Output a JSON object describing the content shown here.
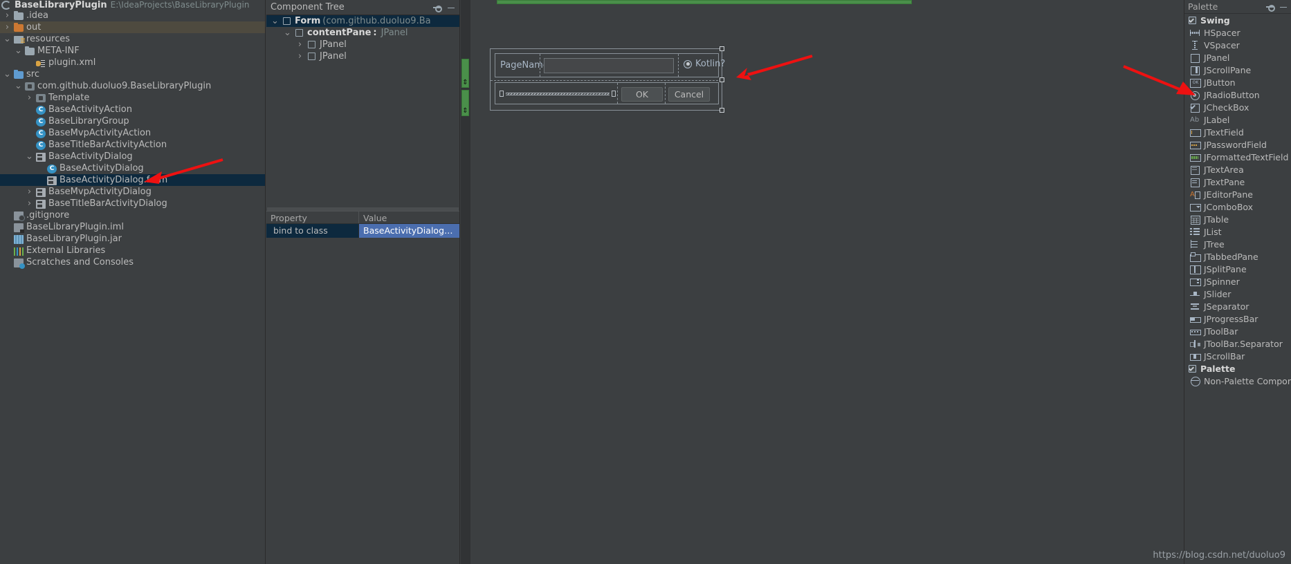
{
  "project": {
    "title": "BaseLibraryPlugin",
    "path": "E:\\IdeaProjects\\BaseLibraryPlugin",
    "items": [
      {
        "label": ".idea",
        "indent": 0,
        "arrow": "collapsed",
        "icon": "folder-gray-icon",
        "state": "normal"
      },
      {
        "label": "out",
        "indent": 0,
        "arrow": "collapsed",
        "icon": "folder-orange-icon",
        "state": "highlight"
      },
      {
        "label": "resources",
        "indent": 0,
        "arrow": "expanded",
        "icon": "resources-folder-icon",
        "state": "normal"
      },
      {
        "label": "META-INF",
        "indent": 1,
        "arrow": "expanded",
        "icon": "folder-gray-icon",
        "state": "normal"
      },
      {
        "label": "plugin.xml",
        "indent": 2,
        "arrow": "none",
        "icon": "xml-file-icon",
        "state": "normal"
      },
      {
        "label": "src",
        "indent": 0,
        "arrow": "expanded",
        "icon": "folder-blue-icon",
        "state": "normal"
      },
      {
        "label": "com.github.duoluo9.BaseLibraryPlugin",
        "indent": 1,
        "arrow": "expanded",
        "icon": "package-icon",
        "state": "normal"
      },
      {
        "label": "Template",
        "indent": 2,
        "arrow": "collapsed",
        "icon": "package-icon",
        "state": "normal"
      },
      {
        "label": "BaseActivityAction",
        "indent": 2,
        "arrow": "none",
        "icon": "class-icon",
        "state": "normal"
      },
      {
        "label": "BaseLibraryGroup",
        "indent": 2,
        "arrow": "none",
        "icon": "class-icon",
        "state": "normal"
      },
      {
        "label": "BaseMvpActivityAction",
        "indent": 2,
        "arrow": "none",
        "icon": "class-icon",
        "state": "normal"
      },
      {
        "label": "BaseTitleBarActivityAction",
        "indent": 2,
        "arrow": "none",
        "icon": "class-icon",
        "state": "normal"
      },
      {
        "label": "BaseActivityDialog",
        "indent": 2,
        "arrow": "expanded",
        "icon": "form-file-icon",
        "state": "normal"
      },
      {
        "label": "BaseActivityDialog",
        "indent": 3,
        "arrow": "none",
        "icon": "class-icon",
        "state": "normal"
      },
      {
        "label": "BaseActivityDialog.form",
        "indent": 3,
        "arrow": "none",
        "icon": "form-file-icon",
        "state": "selected"
      },
      {
        "label": "BaseMvpActivityDialog",
        "indent": 2,
        "arrow": "collapsed",
        "icon": "form-file-icon",
        "state": "normal"
      },
      {
        "label": "BaseTitleBarActivityDialog",
        "indent": 2,
        "arrow": "collapsed",
        "icon": "form-file-icon",
        "state": "normal"
      },
      {
        "label": ".gitignore",
        "indent": 0,
        "arrow": "none",
        "icon": "gitignore-icon",
        "state": "normal"
      },
      {
        "label": "BaseLibraryPlugin.iml",
        "indent": 0,
        "arrow": "none",
        "icon": "iml-file-icon",
        "state": "normal"
      },
      {
        "label": "BaseLibraryPlugin.jar",
        "indent": 0,
        "arrow": "none",
        "icon": "jar-file-icon",
        "state": "normal"
      },
      {
        "label": "External Libraries",
        "indent": -1,
        "arrow": "none",
        "icon": "external-libraries-icon",
        "state": "normal"
      },
      {
        "label": "Scratches and Consoles",
        "indent": -1,
        "arrow": "none",
        "icon": "scratches-icon",
        "state": "normal"
      }
    ]
  },
  "component_tree": {
    "header": "Component Tree",
    "rows": [
      {
        "indent": 0,
        "arrow": "expanded",
        "name": "Form",
        "separator": "",
        "type": "(com.github.duoluo9.Ba",
        "bold": true,
        "selected": true
      },
      {
        "indent": 1,
        "arrow": "expanded",
        "name": "contentPane",
        "separator": ":",
        "type": "JPanel",
        "bold": true,
        "selected": false
      },
      {
        "indent": 2,
        "arrow": "collapsed",
        "name": "JPanel",
        "separator": "",
        "type": "",
        "bold": false,
        "selected": false
      },
      {
        "indent": 2,
        "arrow": "collapsed",
        "name": "JPanel",
        "separator": "",
        "type": "",
        "bold": false,
        "selected": false
      }
    ]
  },
  "properties": {
    "columns": {
      "property": "Property",
      "value": "Value"
    },
    "rows": [
      {
        "property": "bind to class",
        "value": "BaseActivityDialog in co..."
      }
    ]
  },
  "designer": {
    "form": {
      "label_pagename": "PageName:",
      "textfield_value": "",
      "radio_kotlin": "Kotlin?",
      "radio_kotlin_selected": true,
      "button_ok": "OK",
      "button_cancel": "Cancel",
      "hspacer_name": "HSpacer"
    }
  },
  "palette": {
    "header": "Palette",
    "items": [
      {
        "label": "Swing",
        "icon": "checkbox-checked-icon",
        "group": true
      },
      {
        "label": "HSpacer",
        "icon": "hspacer-icon",
        "group": false
      },
      {
        "label": "VSpacer",
        "icon": "vspacer-icon",
        "group": false
      },
      {
        "label": "JPanel",
        "icon": "jpanel-icon",
        "group": false
      },
      {
        "label": "JScrollPane",
        "icon": "jscrollpane-icon",
        "group": false
      },
      {
        "label": "JButton",
        "icon": "jbutton-icon",
        "group": false
      },
      {
        "label": "JRadioButton",
        "icon": "jradiobutton-icon",
        "group": false
      },
      {
        "label": "JCheckBox",
        "icon": "jcheckbox-icon",
        "group": false
      },
      {
        "label": "JLabel",
        "icon": "jlabel-icon",
        "group": false
      },
      {
        "label": "JTextField",
        "icon": "jtextfield-icon",
        "group": false
      },
      {
        "label": "JPasswordField",
        "icon": "jpasswordfield-icon",
        "group": false
      },
      {
        "label": "JFormattedTextField",
        "icon": "jformattedtextfield-icon",
        "group": false
      },
      {
        "label": "JTextArea",
        "icon": "jtextarea-icon",
        "group": false
      },
      {
        "label": "JTextPane",
        "icon": "jtextpane-icon",
        "group": false
      },
      {
        "label": "JEditorPane",
        "icon": "jeditorpane-icon",
        "group": false
      },
      {
        "label": "JComboBox",
        "icon": "jcombobox-icon",
        "group": false
      },
      {
        "label": "JTable",
        "icon": "jtable-icon",
        "group": false
      },
      {
        "label": "JList",
        "icon": "jlist-icon",
        "group": false
      },
      {
        "label": "JTree",
        "icon": "jtree-icon",
        "group": false
      },
      {
        "label": "JTabbedPane",
        "icon": "jtabbedpane-icon",
        "group": false
      },
      {
        "label": "JSplitPane",
        "icon": "jsplitpane-icon",
        "group": false
      },
      {
        "label": "JSpinner",
        "icon": "jspinner-icon",
        "group": false
      },
      {
        "label": "JSlider",
        "icon": "jslider-icon",
        "group": false
      },
      {
        "label": "JSeparator",
        "icon": "jseparator-icon",
        "group": false
      },
      {
        "label": "JProgressBar",
        "icon": "jprogressbar-icon",
        "group": false
      },
      {
        "label": "JToolBar",
        "icon": "jtoolbar-icon",
        "group": false
      },
      {
        "label": "JToolBar.Separator",
        "icon": "jtoolbarseparator-icon",
        "group": false
      },
      {
        "label": "JScrollBar",
        "icon": "jscrollbar-icon",
        "group": false
      },
      {
        "label": "Palette",
        "icon": "checkbox-checked-icon",
        "group": true
      },
      {
        "label": "Non-Palette Component...",
        "icon": "non-palette-icon",
        "group": false
      }
    ]
  },
  "watermark": "https://blog.csdn.net/duoluo9",
  "colors": {
    "background": "#3c3f41",
    "selection": "#0d293e",
    "value_cell": "#4b6eaf",
    "annotation_red": "#ee1111",
    "highlight_row": "#4e4a3f",
    "green_guide": "#4a8f4a"
  }
}
